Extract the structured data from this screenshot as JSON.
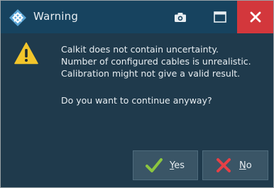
{
  "window": {
    "title": "Warning",
    "app_icon": "rohde-schwarz-diamond-icon",
    "controls": {
      "camera_icon": "camera-icon",
      "maximize_icon": "maximize-icon",
      "close_icon": "close-icon"
    }
  },
  "message": {
    "icon": "warning-triangle-icon",
    "lines": [
      "Calkit does not contain uncertainty.",
      "Number of configured cables is unrealistic.",
      "Calibration might not give a valid result."
    ],
    "question": "Do you want to continue anyway?"
  },
  "buttons": {
    "yes": {
      "mnemonic": "Y",
      "rest": "es",
      "icon": "check-icon"
    },
    "no": {
      "mnemonic": "N",
      "rest": "o",
      "icon": "x-icon"
    }
  },
  "colors": {
    "titlebar": "#17435f",
    "body": "#1f3a4c",
    "close": "#d3373c",
    "button": "#3a5566",
    "warning": "#f2c52b",
    "check": "#8cc63f",
    "cross": "#e64046"
  }
}
